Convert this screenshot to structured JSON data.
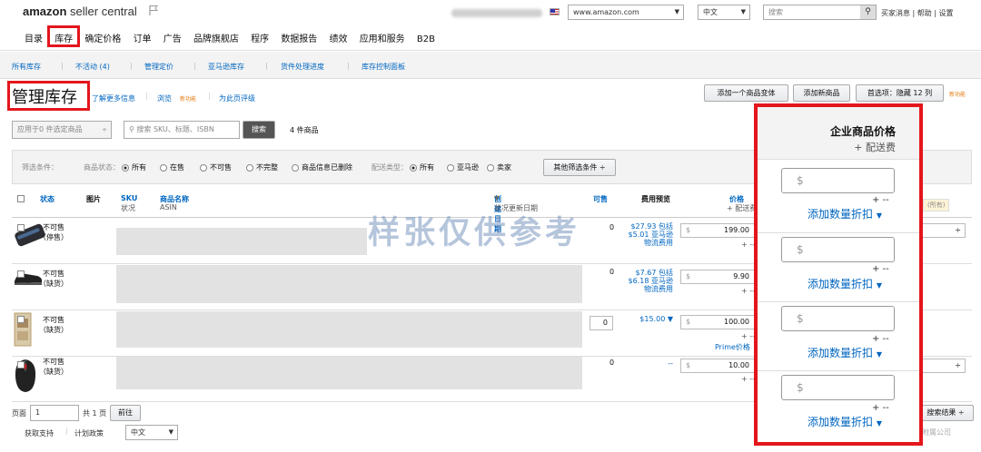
{
  "header": {
    "logo_brand": "amazon",
    "logo_suffix": "seller central",
    "marketplace": "www.amazon.com",
    "language": "中文",
    "search_placeholder": "搜索",
    "top_links": "买家消息 | 帮助 | 设置"
  },
  "nav": [
    "目录",
    "库存",
    "确定价格",
    "订单",
    "广告",
    "品牌旗舰店",
    "程序",
    "数据报告",
    "绩效",
    "应用和服务",
    "B2B"
  ],
  "subnav": [
    "所有库存",
    "不活动 (4)",
    "管理定价",
    "亚马逊库存",
    "货件处理进度",
    "库存控制面板"
  ],
  "page": {
    "title": "管理库存",
    "learn_more": "了解更多信息",
    "browse": "浏览",
    "new_feature": "新功能",
    "rate_page": "为此页评级",
    "add_variation": "添加一个商品变体",
    "add_product": "添加新商品",
    "preferences": "首选项：隐藏 12 列",
    "new_feature2": "新功能"
  },
  "toolbar": {
    "bulk_action": "应用于0 件选定商品",
    "search_placeholder": "搜索 SKU、标题、ISBN",
    "search_button": "搜索",
    "count": "4 件商品"
  },
  "filters": {
    "label": "筛选条件：",
    "status_label": "商品状态：",
    "status_options": [
      "所有",
      "在售",
      "不可售",
      "不完整",
      "商品信息已删除"
    ],
    "fulfill_label": "配送类型：",
    "fulfill_options": [
      "所有",
      "亚马逊",
      "卖家"
    ],
    "more_button": "其他筛选条件"
  },
  "columns": {
    "status": "状态",
    "image": "图片",
    "sku": "SKU",
    "condition": "状况",
    "name": "商品名称",
    "asin": "ASIN",
    "created": "创建日期",
    "created_sub": "状况更新日期",
    "available": "可售",
    "fee": "费用预览",
    "price": "价格",
    "price_sub": "+ 配送费",
    "right_tag": "(所有)"
  },
  "rows": [
    {
      "status": "不可售（停售）",
      "qty": "0",
      "fee": "$27.93 包括 $5.01 亚马逊物流费用",
      "price": "199.00"
    },
    {
      "status": "不可售（缺货）",
      "qty": "0",
      "fee": "$7.67 包括 $6.18 亚马逊物流费用",
      "price": "9.90"
    },
    {
      "status": "不可售（缺货）",
      "qty": "0",
      "fee": "$15.00",
      "price": "100.00",
      "extra": "Prime价格"
    },
    {
      "status": "不可售（缺货）",
      "qty": "0",
      "fee": "--",
      "price": "10.00"
    }
  ],
  "watermark": "样张仅供参考",
  "popup": {
    "title": "企业商品价格",
    "subtitle": "+ 配送费",
    "currency": "$",
    "add_discount": "添加数量折扣",
    "pm": "+ --"
  },
  "footer": {
    "page_label": "页面",
    "page_value": "1",
    "total": "共 1 页",
    "go": "前往",
    "support": "获取支持",
    "policies": "计划政策",
    "language": "中文",
    "right_btn": "搜索结果",
    "right_text": "附属公司"
  }
}
